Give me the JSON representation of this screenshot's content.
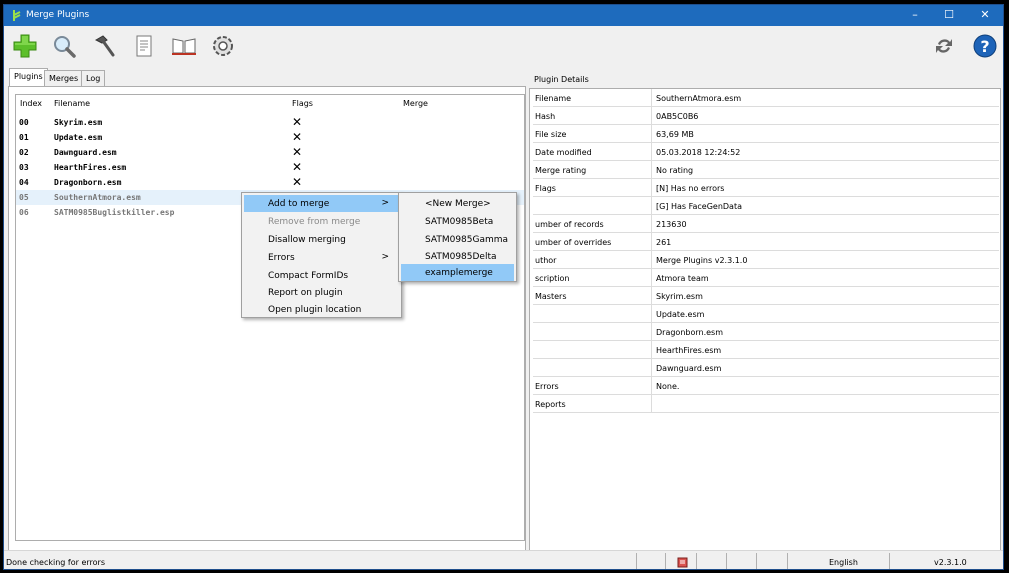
{
  "window": {
    "title": "Merge Plugins",
    "controls": {
      "minimize": "–",
      "maximize": "☐",
      "close": "✕"
    }
  },
  "toolbar": {
    "left_icons": [
      "add-merge-icon",
      "search-icon",
      "hammer-icon",
      "document-icon",
      "book-icon",
      "gear-icon"
    ],
    "right_icons": [
      "refresh-icon",
      "help-icon"
    ]
  },
  "tabs": [
    "Plugins",
    "Merges",
    "Log"
  ],
  "plugins_table": {
    "headers": {
      "index": "Index",
      "filename": "Filename",
      "flags": "Flags",
      "merge": "Merge"
    },
    "rows": [
      {
        "index": "00",
        "filename": "Skyrim.esm",
        "flag": "✕"
      },
      {
        "index": "01",
        "filename": "Update.esm",
        "flag": "✕"
      },
      {
        "index": "02",
        "filename": "Dawnguard.esm",
        "flag": "✕"
      },
      {
        "index": "03",
        "filename": "HearthFires.esm",
        "flag": "✕"
      },
      {
        "index": "04",
        "filename": "Dragonborn.esm",
        "flag": "✕"
      },
      {
        "index": "05",
        "filename": "SouthernAtmora.esm",
        "flag": ""
      },
      {
        "index": "06",
        "filename": "SATM0985Buglistkiller.esp",
        "flag": ""
      }
    ]
  },
  "context_menu": {
    "items": [
      {
        "label": "Add to merge",
        "submenu": true,
        "state": "highlighted"
      },
      {
        "label": "Remove from merge",
        "state": "disabled"
      },
      {
        "label": "Disallow merging"
      },
      {
        "label": "Errors",
        "submenu": true
      },
      {
        "label": "Compact FormIDs"
      },
      {
        "label": "Report on plugin"
      },
      {
        "label": "Open plugin location"
      }
    ],
    "arrow": ">"
  },
  "submenu": {
    "items": [
      "<New Merge>",
      "SATM0985Beta",
      "SATM0985Gamma",
      "SATM0985Delta",
      "examplemerge"
    ],
    "highlighted": "examplemerge"
  },
  "details": {
    "panel_label": "Plugin Details",
    "rows": [
      {
        "key": "Filename",
        "value": "SouthernAtmora.esm"
      },
      {
        "key": "Hash",
        "value": "0AB5C0B6"
      },
      {
        "key": "File size",
        "value": "63,69 MB"
      },
      {
        "key": "Date modified",
        "value": "05.03.2018 12:24:52"
      },
      {
        "key": "Merge rating",
        "value": "No rating"
      },
      {
        "key": "Flags",
        "value": "[N] Has no errors"
      },
      {
        "key": "",
        "value": "[G] Has FaceGenData"
      },
      {
        "key": "umber of records",
        "value": "213630"
      },
      {
        "key": "umber of overrides",
        "value": "261"
      },
      {
        "key": "uthor",
        "value": "Merge Plugins v2.3.1.0"
      },
      {
        "key": "scription",
        "value": "Atmora team"
      },
      {
        "key": "Masters",
        "value": "Skyrim.esm"
      },
      {
        "key": "",
        "value": "Update.esm"
      },
      {
        "key": "",
        "value": "Dragonborn.esm"
      },
      {
        "key": "",
        "value": "HearthFires.esm"
      },
      {
        "key": "",
        "value": "Dawnguard.esm"
      },
      {
        "key": "Errors",
        "value": "None."
      },
      {
        "key": "Reports",
        "value": ""
      }
    ]
  },
  "status": {
    "message": "Done checking for errors",
    "language": "English",
    "version": "v2.3.1.0"
  },
  "colors": {
    "titlebar": "#1e6bbd",
    "menu_highlight": "#91c9f7",
    "selection": "#e5f1fb"
  }
}
